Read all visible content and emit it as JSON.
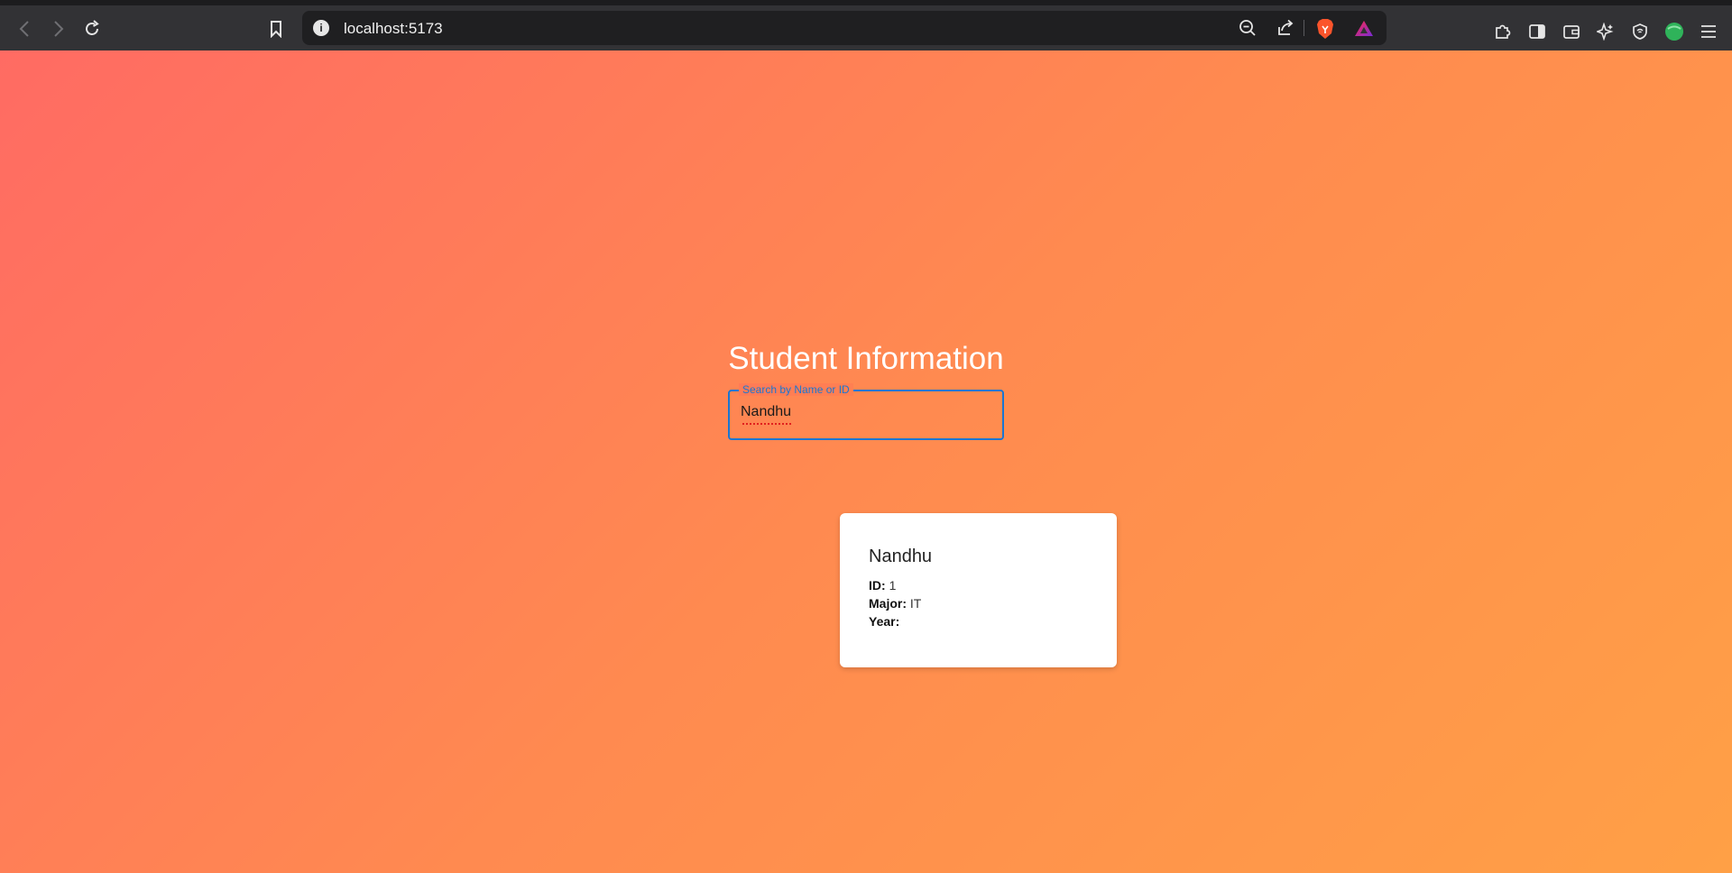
{
  "browser": {
    "url": "localhost:5173",
    "icons": {
      "back": "back-icon",
      "forward": "forward-icon",
      "reload": "reload-icon",
      "bookmark": "bookmark-icon",
      "site_info": "info-icon",
      "zoom": "zoom-out-icon",
      "share": "share-icon",
      "brave_shield": "brave-lion-icon",
      "rewards": "brave-rewards-icon",
      "extensions": "puzzle-icon",
      "sidebar": "sidebar-icon",
      "wallet": "wallet-icon",
      "leo": "sparkle-icon",
      "vpn": "shield-icon",
      "profile": "profile-icon",
      "menu": "menu-icon"
    }
  },
  "page": {
    "title": "Student Information",
    "search": {
      "label": "Search by Name or ID",
      "value": "Nandhu"
    },
    "result": {
      "name": "Nandhu",
      "id_label": "ID:",
      "id_value": "1",
      "major_label": "Major:",
      "major_value": "IT",
      "year_label": "Year:",
      "year_value": ""
    }
  },
  "colors": {
    "gradient_start": "#ff6b63",
    "gradient_end": "#ffa046",
    "focus_blue": "#1976d2",
    "card_bg": "#ffffff"
  }
}
